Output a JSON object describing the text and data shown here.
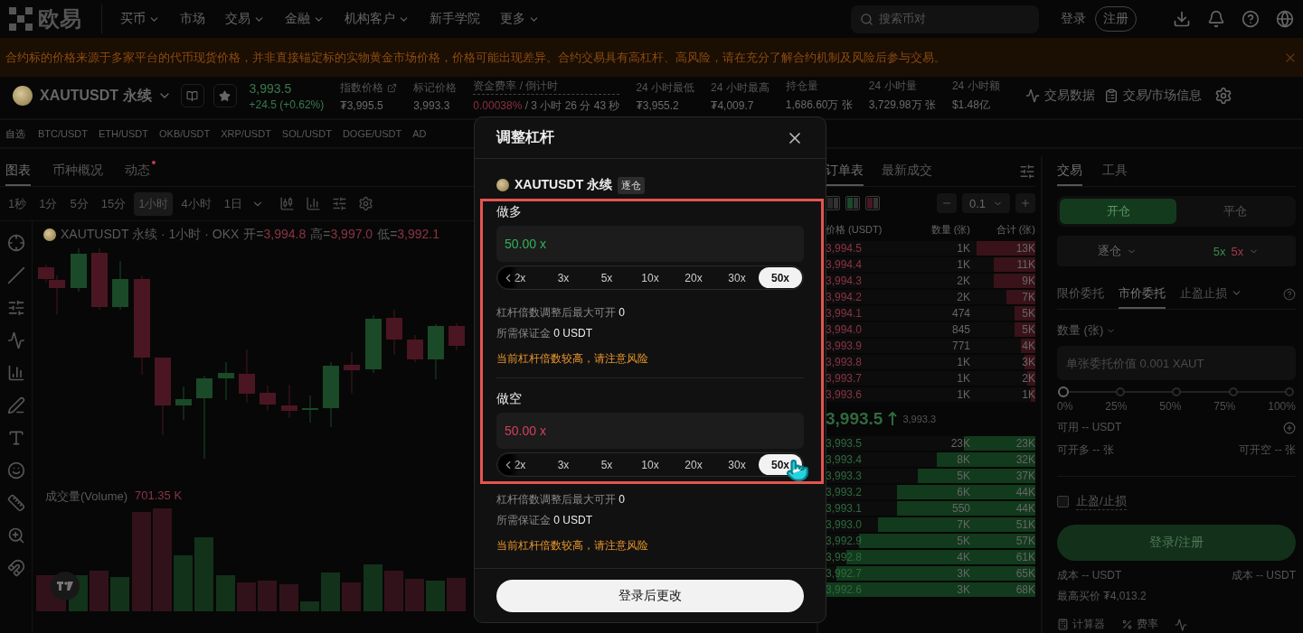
{
  "nav": {
    "logo": "欧易",
    "menu": [
      {
        "label": "买币",
        "dropdown": true
      },
      {
        "label": "市场",
        "dropdown": false
      },
      {
        "label": "交易",
        "dropdown": true
      },
      {
        "label": "金融",
        "dropdown": true
      },
      {
        "label": "机构客户",
        "dropdown": true
      },
      {
        "label": "新手学院",
        "dropdown": false
      },
      {
        "label": "更多",
        "dropdown": true
      }
    ],
    "search": {
      "placeholder": "搜索币对"
    },
    "login": "登录",
    "register": "注册"
  },
  "banner": {
    "text": "合约标的价格来源于多家平台的代币现货价格，并非直接锚定标的实物黄金市场价格，价格可能出现差异。合约交易具有高杠杆、高风险，请在充分了解合约机制及风险后参与交易。"
  },
  "ticker": {
    "symbol": "XAUTUSDT 永续",
    "price": "3,993.5",
    "change": "+24.5 (+0.62%)",
    "stats": [
      {
        "kind": "link",
        "label": "指数价格",
        "value": "₮3,995.5"
      },
      {
        "kind": "plain",
        "label": "标记价格",
        "value": "3,993.3"
      },
      {
        "kind": "funding",
        "label": "资金费率 / 倒计时",
        "value": "0.00038%",
        "extra": "/ 3 小时 26 分 43 秒"
      },
      {
        "kind": "plain",
        "label": "24 小时最低",
        "value": "₮3,955.2"
      },
      {
        "kind": "plain",
        "label": "24 小时最高",
        "value": "₮4,009.7"
      },
      {
        "kind": "plain",
        "label": "持仓量",
        "value": "1,686.60万 张"
      },
      {
        "kind": "plain",
        "label": "24 小时量",
        "value": "3,729.98万 张"
      },
      {
        "kind": "plain",
        "label": "24 小时额",
        "value": "$1.48亿"
      }
    ],
    "links": [
      "交易数据",
      "交易/市场信息"
    ]
  },
  "watchlist": {
    "label": "自选",
    "pairs": [
      "BTC/USDT",
      "ETH/USDT",
      "OKB/USDT",
      "XRP/USDT",
      "SOL/USDT",
      "DOGE/USDT",
      "AD"
    ]
  },
  "chart_panel": {
    "tabs": [
      {
        "label": "图表",
        "selected": true,
        "badge": false
      },
      {
        "label": "币种概况",
        "selected": false,
        "badge": false
      },
      {
        "label": "动态",
        "selected": false,
        "badge": true
      }
    ],
    "intervals": [
      {
        "label": "1秒",
        "selected": false,
        "dropdown": false
      },
      {
        "label": "1分",
        "selected": false,
        "dropdown": false
      },
      {
        "label": "5分",
        "selected": false,
        "dropdown": false
      },
      {
        "label": "15分",
        "selected": false,
        "dropdown": false
      },
      {
        "label": "1小时",
        "selected": true,
        "dropdown": false
      },
      {
        "label": "4小时",
        "selected": false,
        "dropdown": false
      },
      {
        "label": "1日",
        "selected": false,
        "dropdown": true
      }
    ],
    "title": "XAUTUSDT 永续 · 1小时 · OKX",
    "ohlc": [
      {
        "label": "开=",
        "value": "3,994.8"
      },
      {
        "label": "高=",
        "value": "3,997.0"
      },
      {
        "label": "低=",
        "value": "3,992.1"
      }
    ],
    "volume_label": "成交量(Volume)",
    "volume_value": "701.35 K"
  },
  "orderbook": {
    "tabs": [
      {
        "label": "订单表",
        "selected": true
      },
      {
        "label": "最新成交",
        "selected": false
      }
    ],
    "precision": "0.1",
    "columns": [
      "价格 (USDT)",
      "数量 (张)",
      "合计 (张)"
    ],
    "asks": [
      {
        "price": "3,994.5",
        "size": "1K",
        "total": "13K",
        "level": 0.28
      },
      {
        "price": "3,994.4",
        "size": "1K",
        "total": "11K",
        "level": 0.2
      },
      {
        "price": "3,994.3",
        "size": "2K",
        "total": "9K",
        "level": 0.2
      },
      {
        "price": "3,994.2",
        "size": "2K",
        "total": "7K",
        "level": 0.14
      },
      {
        "price": "3,994.1",
        "size": "474",
        "total": "5K",
        "level": 0.1
      },
      {
        "price": "3,994.0",
        "size": "845",
        "total": "5K",
        "level": 0.1
      },
      {
        "price": "3,993.9",
        "size": "771",
        "total": "4K",
        "level": 0.07
      },
      {
        "price": "3,993.8",
        "size": "1K",
        "total": "3K",
        "level": 0.05
      },
      {
        "price": "3,993.7",
        "size": "1K",
        "total": "2K",
        "level": 0.04
      },
      {
        "price": "3,993.6",
        "size": "1K",
        "total": "1K",
        "level": 0.02
      }
    ],
    "last_price": "3,993.5",
    "mark_price": "3,993.3",
    "bids": [
      {
        "price": "3,993.5",
        "size": "23K",
        "total": "23K",
        "level": 0.34
      },
      {
        "price": "3,993.4",
        "size": "8K",
        "total": "32K",
        "level": 0.47
      },
      {
        "price": "3,993.3",
        "size": "5K",
        "total": "37K",
        "level": 0.56
      },
      {
        "price": "3,993.2",
        "size": "6K",
        "total": "44K",
        "level": 0.66
      },
      {
        "price": "3,993.1",
        "size": "550",
        "total": "44K",
        "level": 0.66
      },
      {
        "price": "3,993.0",
        "size": "7K",
        "total": "51K",
        "level": 0.75
      },
      {
        "price": "3,992.9",
        "size": "5K",
        "total": "57K",
        "level": 0.84
      },
      {
        "price": "3,992.8",
        "size": "4K",
        "total": "61K",
        "level": 0.9
      },
      {
        "price": "3,992.7",
        "size": "3K",
        "total": "65K",
        "level": 0.95
      },
      {
        "price": "3,992.6",
        "size": "3K",
        "total": "68K",
        "level": 1
      }
    ]
  },
  "trade": {
    "tabs": [
      {
        "label": "交易",
        "selected": true
      },
      {
        "label": "工具",
        "selected": false
      }
    ],
    "sides": [
      {
        "label": "开仓",
        "selected": true
      },
      {
        "label": "平仓",
        "selected": false
      }
    ],
    "margin_mode": "逐仓",
    "leverage_long": "5x",
    "leverage_short": "5x",
    "order_types": [
      {
        "label": "限价委托",
        "selected": false,
        "dropdown": false
      },
      {
        "label": "市价委托",
        "selected": true,
        "dropdown": false
      },
      {
        "label": "止盈止损",
        "selected": false,
        "dropdown": true
      }
    ],
    "qty_label": "数量 (张)",
    "qty_placeholder": "单张委托价值 0.001 XAUT",
    "slider": {
      "level": 0,
      "marks": [
        "0%",
        "25%",
        "50%",
        "75%",
        "100%"
      ]
    },
    "available": "可用 -- USDT",
    "can_long": "可开多 -- 张",
    "can_short": "可开空 -- 张",
    "tpsl": {
      "label": "止盈/止损",
      "checked": false
    },
    "submit": "登录/注册",
    "cost_long": "成本 -- USDT",
    "cost_short": "成本 -- USDT",
    "max_buy": "最高买价 ₮4,013.2",
    "tools": [
      "计算器",
      "费率"
    ]
  },
  "modal": {
    "title": "调整杠杆",
    "symbol": "XAUTUSDT 永续",
    "margin_badge": "逐仓",
    "sections": [
      {
        "kind": "long",
        "label": "做多",
        "value": "50.00 x",
        "options": [
          {
            "label": "2x",
            "selected": false
          },
          {
            "label": "3x",
            "selected": false
          },
          {
            "label": "5x",
            "selected": false
          },
          {
            "label": "10x",
            "selected": false
          },
          {
            "label": "20x",
            "selected": false
          },
          {
            "label": "30x",
            "selected": false
          },
          {
            "label": "50x",
            "selected": true
          }
        ],
        "max_open_label": "杠杆倍数调整后最大可开",
        "max_open": "0",
        "margin_label": "所需保证金",
        "margin": "0 USDT",
        "warning": "当前杠杆倍数较高，请注意风险"
      },
      {
        "kind": "short",
        "label": "做空",
        "value": "50.00 x",
        "options": [
          {
            "label": "2x",
            "selected": false
          },
          {
            "label": "3x",
            "selected": false
          },
          {
            "label": "5x",
            "selected": false
          },
          {
            "label": "10x",
            "selected": false
          },
          {
            "label": "20x",
            "selected": false
          },
          {
            "label": "30x",
            "selected": false
          },
          {
            "label": "50x",
            "selected": true
          }
        ],
        "max_open_label": "杠杆倍数调整后最大可开",
        "max_open": "0",
        "margin_label": "所需保证金",
        "margin": "0 USDT",
        "warning": "当前杠杆倍数较高，请注意风险"
      }
    ],
    "button": "登录后更改"
  }
}
